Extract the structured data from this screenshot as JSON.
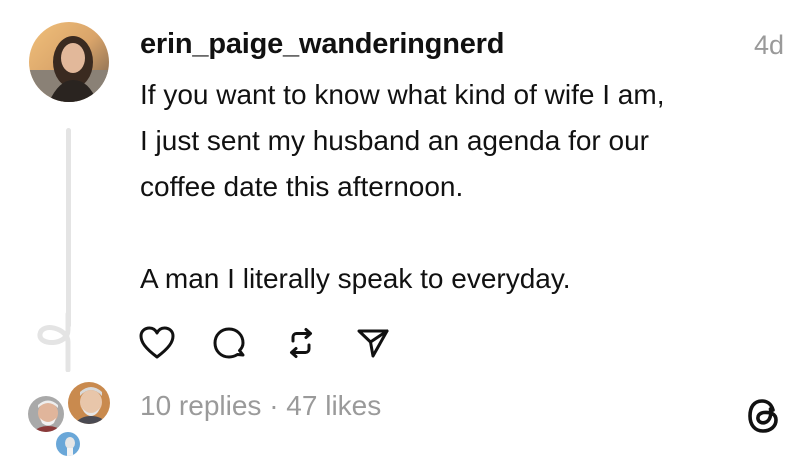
{
  "post": {
    "username": "erin_paige_wanderingnerd",
    "timestamp": "4d",
    "lines": [
      "If you want to know what kind of wife I am,",
      "I just sent my husband an agenda for our",
      "coffee date this afternoon.",
      "A man I literally speak to everyday."
    ],
    "replies": "10 replies",
    "separator": "·",
    "likes": "47 likes"
  },
  "actions": [
    "heart-icon",
    "comment-icon",
    "repost-icon",
    "share-icon"
  ],
  "brand": {
    "logo": "threads-icon"
  },
  "colors": {
    "text": "#111111",
    "muted": "#9a9a9a",
    "thread_line": "#e4e4e4"
  }
}
